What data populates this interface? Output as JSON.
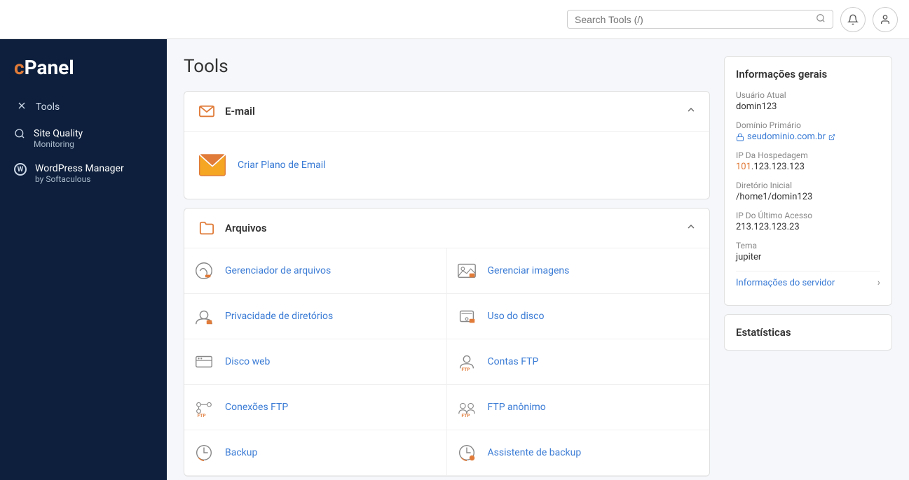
{
  "topbar": {
    "search_placeholder": "Search Tools (/)",
    "search_icon": "🔍"
  },
  "sidebar": {
    "logo": "cPanel",
    "items": [
      {
        "id": "tools",
        "label": "Tools",
        "icon": "✕"
      },
      {
        "id": "site-quality",
        "label": "Site Quality Monitoring",
        "icon": "🔍",
        "multiline": true,
        "line1": "Site Quality",
        "line2": "Monitoring"
      },
      {
        "id": "wordpress",
        "label": "WordPress Manager by Softaculous",
        "icon": "W",
        "multiline": true,
        "line1": "WordPress Manager",
        "line2": "by Softaculous"
      }
    ]
  },
  "main": {
    "title": "Tools",
    "sections": [
      {
        "id": "email",
        "title": "E-mail",
        "collapsed": false,
        "items": [
          {
            "id": "create-email-plan",
            "label": "Criar Plano de Email",
            "icon": "email"
          }
        ]
      },
      {
        "id": "arquivos",
        "title": "Arquivos",
        "collapsed": false,
        "items": [
          {
            "id": "file-manager",
            "label": "Gerenciador de arquivos",
            "icon": "file-manager"
          },
          {
            "id": "manage-images",
            "label": "Gerenciar imagens",
            "icon": "images"
          },
          {
            "id": "dir-privacy",
            "label": "Privacidade de diretórios",
            "icon": "privacy"
          },
          {
            "id": "disk-usage",
            "label": "Uso do disco",
            "icon": "disk"
          },
          {
            "id": "web-disk",
            "label": "Disco web",
            "icon": "web-disk"
          },
          {
            "id": "ftp-accounts",
            "label": "Contas FTP",
            "icon": "ftp"
          },
          {
            "id": "ftp-connections",
            "label": "Conexões FTP",
            "icon": "ftp-connections"
          },
          {
            "id": "anon-ftp",
            "label": "FTP anônimo",
            "icon": "anon-ftp"
          },
          {
            "id": "backup",
            "label": "Backup",
            "icon": "backup"
          },
          {
            "id": "backup-wizard",
            "label": "Assistente de backup",
            "icon": "backup-wizard"
          }
        ]
      }
    ]
  },
  "right_panel": {
    "info_title": "Informações gerais",
    "usuario_label": "Usuário Atual",
    "usuario_value": "domin123",
    "dominio_label": "Domínio Primário",
    "dominio_value": "seudominio.com.br",
    "ip_hospedagem_label": "IP Da Hospedagem",
    "ip_hospedagem_value": "101.123.123.123",
    "ip_highlight": "101",
    "diretorio_label": "Diretório Inicial",
    "diretorio_value": "/home1/domin123",
    "ultimo_acesso_label": "IP Do Último Acesso",
    "ultimo_acesso_value": "213.123.123.23",
    "tema_label": "Tema",
    "tema_value": "jupiter",
    "server_info_label": "Informações do servidor",
    "stats_title": "Estatísticas"
  }
}
